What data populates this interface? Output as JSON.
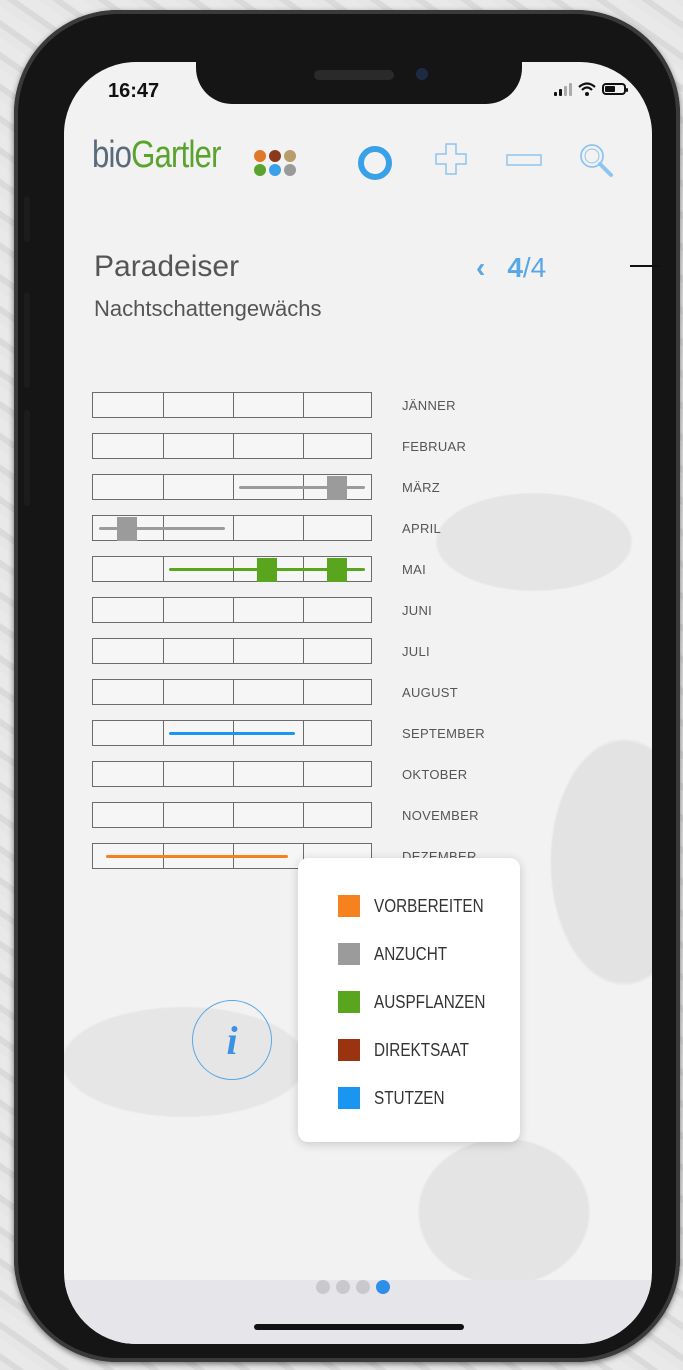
{
  "status": {
    "time": "16:47"
  },
  "header": {
    "logo_part1": "bio",
    "logo_part2": "Gartler",
    "dot_colors": [
      "#e0782a",
      "#8a3a1c",
      "#b89c6a",
      "#5aa32c",
      "#3aa0e8",
      "#9a9a9a"
    ],
    "icons": [
      "menu-dots-icon",
      "ring-icon",
      "plus-icon",
      "minus-icon",
      "search-icon"
    ]
  },
  "plant": {
    "name": "Paradeiser",
    "family": "Nachtschattengewächs"
  },
  "pager": {
    "current": "4",
    "total": "/4"
  },
  "calendar": {
    "months": [
      "JÄNNER",
      "FEBRUAR",
      "MÄRZ",
      "APRIL",
      "MAI",
      "JUNI",
      "JULI",
      "AUGUST",
      "SEPTEMBER",
      "OKTOBER",
      "NOVEMBER",
      "DEZEMBER"
    ],
    "activities": [
      {
        "month": "MÄRZ",
        "type": "ANZUCHT",
        "line_from": 2.1,
        "line_to": 3.9,
        "marks": [
          3.5
        ]
      },
      {
        "month": "APRIL",
        "type": "ANZUCHT",
        "line_from": 0.1,
        "line_to": 1.9,
        "marks": [
          0.5
        ]
      },
      {
        "month": "MAI",
        "type": "AUSPFLANZEN",
        "line_from": 1.1,
        "line_to": 3.9,
        "marks": [
          2.5,
          3.5
        ]
      },
      {
        "month": "SEPTEMBER",
        "type": "STUTZEN",
        "line_from": 1.1,
        "line_to": 2.9,
        "marks": []
      },
      {
        "month": "DEZEMBER",
        "type": "VORBEREITEN",
        "line_from": 0.2,
        "line_to": 2.8,
        "marks": []
      }
    ]
  },
  "legend": [
    {
      "label": "VORBEREITEN",
      "color": "#f5821f"
    },
    {
      "label": "ANZUCHT",
      "color": "#9b9b9b"
    },
    {
      "label": "AUSPFLANZEN",
      "color": "#5aa51e"
    },
    {
      "label": "DIREKTSAAT",
      "color": "#9a3410"
    },
    {
      "label": "STUTZEN",
      "color": "#1a96f0"
    }
  ],
  "info_button": {
    "label": "i"
  },
  "page_indicator": {
    "pages": 4,
    "active": 4
  }
}
